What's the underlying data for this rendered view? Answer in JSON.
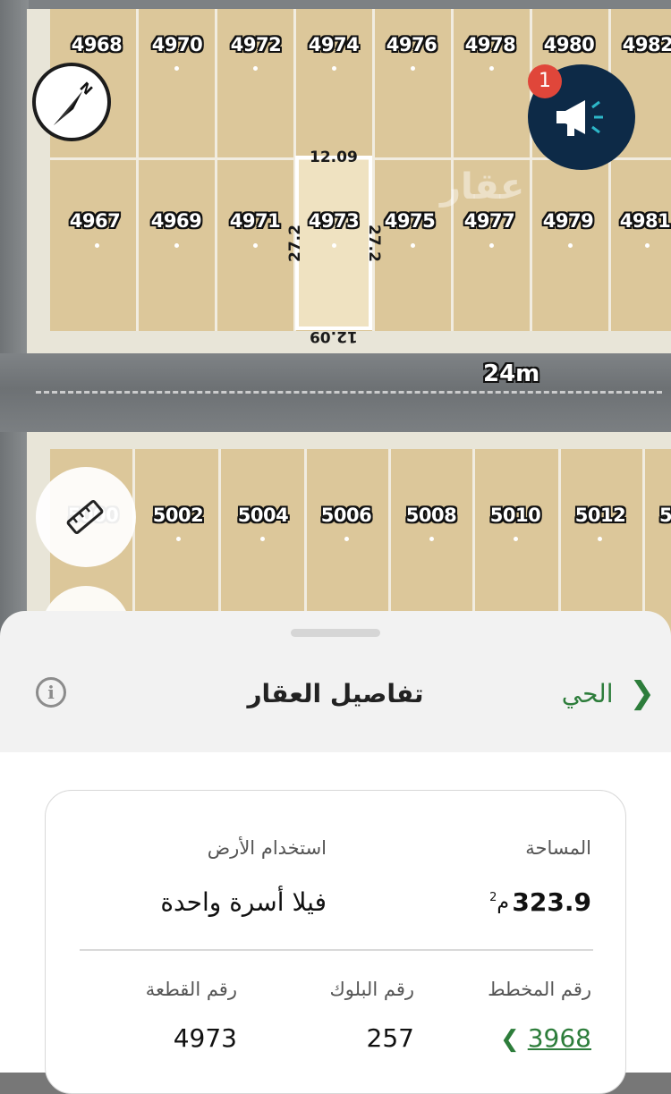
{
  "map": {
    "top_row_lots": [
      "4968",
      "4970",
      "4972",
      "4974",
      "4976",
      "4978",
      "4980",
      "4982"
    ],
    "middle_row_lots": [
      "4967",
      "4969",
      "4971",
      "4973",
      "4975",
      "4977",
      "4979",
      "4981"
    ],
    "bottom_row_lots": [
      "5000",
      "5002",
      "5004",
      "5006",
      "5008",
      "5010",
      "5012",
      "5"
    ],
    "selected_lot": {
      "number": "4973",
      "dim_top": "12.09",
      "dim_bottom": "12.09",
      "dim_left": "27.2",
      "dim_right": "27.2"
    },
    "road_width_label": "24m",
    "compass_label": "N",
    "promo_badge_count": "1",
    "watermark": "عقار",
    "colors": {
      "lot_fill": "#dcc79a",
      "selected_border": "#ffffff",
      "promo_bg": "#0d2a47",
      "badge_bg": "#e0463a"
    },
    "icons": [
      "compass-icon",
      "megaphone-icon",
      "ruler-icon"
    ]
  },
  "sheet": {
    "title": "تفاصيل العقار",
    "nav_link_label": "الحي",
    "info_icon": "i",
    "accent_color": "#2d7d3b",
    "fields": {
      "area_label": "المساحة",
      "area_value": "323.9",
      "area_unit": "م",
      "area_unit_sup": "2",
      "land_use_label": "استخدام الأرض",
      "land_use_value": "فيلا أسرة واحدة",
      "plan_label": "رقم المخطط",
      "plan_value": "3968",
      "block_label": "رقم البلوك",
      "block_value": "257",
      "parcel_label": "رقم القطعة",
      "parcel_value": "4973"
    }
  }
}
